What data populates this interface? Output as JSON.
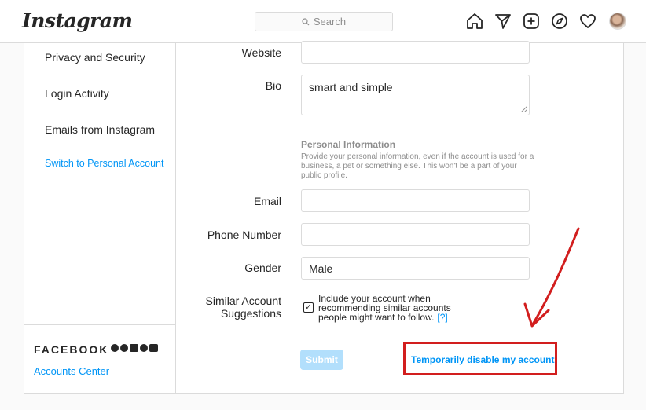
{
  "header": {
    "logo": "Instagram",
    "search_placeholder": "Search",
    "nav_icons": [
      "home-icon",
      "direct-icon",
      "new-post-icon",
      "explore-icon",
      "activity-icon",
      "profile-avatar"
    ]
  },
  "sidebar": {
    "items": [
      {
        "label": "Privacy and Security"
      },
      {
        "label": "Login Activity"
      },
      {
        "label": "Emails from Instagram"
      },
      {
        "label": "Switch to Personal Account",
        "active": true
      }
    ],
    "footer": {
      "brand": "FACEBOOK",
      "brand_icons": [
        "facebook-icon",
        "messenger-icon",
        "instagram-icon",
        "whatsapp-icon",
        "oculus-icon"
      ],
      "accounts_center": "Accounts Center"
    }
  },
  "form": {
    "website": {
      "label": "Website",
      "value": ""
    },
    "bio": {
      "label": "Bio",
      "value": "smart and simple"
    },
    "personal_info": {
      "title": "Personal Information",
      "text": "Provide your personal information, even if the account is used for a business, a pet or something else. This won't be a part of your public profile."
    },
    "email": {
      "label": "Email",
      "value": ""
    },
    "phone": {
      "label": "Phone Number",
      "value": ""
    },
    "gender": {
      "label": "Gender",
      "value": "Male"
    },
    "similar": {
      "label_line1": "Similar Account",
      "label_line2": "Suggestions",
      "checked": true,
      "text": "Include your account when recommending similar accounts people might want to follow.",
      "help": "[?]"
    },
    "submit_label": "Submit",
    "disable_link": "Temporarily disable my account"
  },
  "colors": {
    "link": "#0095f6",
    "highlight_box": "#d21e1e",
    "submit_disabled": "#b2dffc"
  }
}
